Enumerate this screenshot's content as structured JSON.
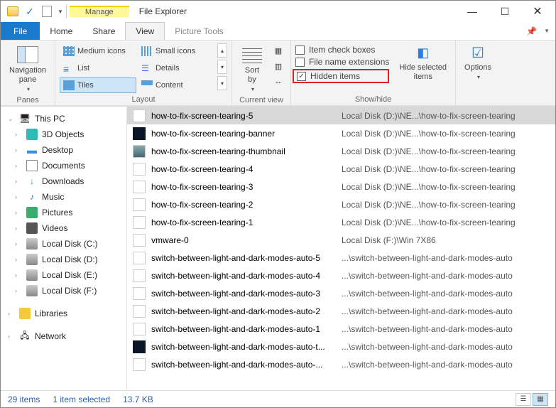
{
  "title": "File Explorer",
  "contextual_tab": "Manage",
  "menu": {
    "file": "File",
    "home": "Home",
    "share": "Share",
    "view": "View",
    "picture_tools": "Picture Tools"
  },
  "ribbon": {
    "panes": {
      "label": "Panes",
      "nav_pane": "Navigation\npane"
    },
    "layout": {
      "label": "Layout",
      "medium": "Medium icons",
      "small": "Small icons",
      "list": "List",
      "details": "Details",
      "tiles": "Tiles",
      "content": "Content"
    },
    "current_view": {
      "label": "Current view",
      "sort": "Sort\nby"
    },
    "showhide": {
      "label": "Show/hide",
      "item_check": "Item check boxes",
      "file_ext": "File name extensions",
      "hidden": "Hidden items",
      "hide_selected": "Hide selected\nitems"
    },
    "options": "Options"
  },
  "tree": {
    "this_pc": "This PC",
    "objects3d": "3D Objects",
    "desktop": "Desktop",
    "documents": "Documents",
    "downloads": "Downloads",
    "music": "Music",
    "pictures": "Pictures",
    "videos": "Videos",
    "disk_c": "Local Disk (C:)",
    "disk_d": "Local Disk (D:)",
    "disk_e": "Local Disk (E:)",
    "disk_f": "Local Disk (F:)",
    "libraries": "Libraries",
    "network": "Network"
  },
  "files": [
    {
      "name": "how-to-fix-screen-tearing-5",
      "path": "Local Disk (D:)\\NE...\\how-to-fix-screen-tearing",
      "thumb": "",
      "selected": true
    },
    {
      "name": "how-to-fix-screen-tearing-banner",
      "path": "Local Disk (D:)\\NE...\\how-to-fix-screen-tearing",
      "thumb": "dark"
    },
    {
      "name": "how-to-fix-screen-tearing-thumbnail",
      "path": "Local Disk (D:)\\NE...\\how-to-fix-screen-tearing",
      "thumb": "photo"
    },
    {
      "name": "how-to-fix-screen-tearing-4",
      "path": "Local Disk (D:)\\NE...\\how-to-fix-screen-tearing",
      "thumb": ""
    },
    {
      "name": "how-to-fix-screen-tearing-3",
      "path": "Local Disk (D:)\\NE...\\how-to-fix-screen-tearing",
      "thumb": ""
    },
    {
      "name": "how-to-fix-screen-tearing-2",
      "path": "Local Disk (D:)\\NE...\\how-to-fix-screen-tearing",
      "thumb": ""
    },
    {
      "name": "how-to-fix-screen-tearing-1",
      "path": "Local Disk (D:)\\NE...\\how-to-fix-screen-tearing",
      "thumb": ""
    },
    {
      "name": "vmware-0",
      "path": "Local Disk (F:)\\Win 7X86",
      "thumb": ""
    },
    {
      "name": "switch-between-light-and-dark-modes-auto-5",
      "path": "...\\switch-between-light-and-dark-modes-auto",
      "thumb": ""
    },
    {
      "name": "switch-between-light-and-dark-modes-auto-4",
      "path": "...\\switch-between-light-and-dark-modes-auto",
      "thumb": ""
    },
    {
      "name": "switch-between-light-and-dark-modes-auto-3",
      "path": "...\\switch-between-light-and-dark-modes-auto",
      "thumb": ""
    },
    {
      "name": "switch-between-light-and-dark-modes-auto-2",
      "path": "...\\switch-between-light-and-dark-modes-auto",
      "thumb": ""
    },
    {
      "name": "switch-between-light-and-dark-modes-auto-1",
      "path": "...\\switch-between-light-and-dark-modes-auto",
      "thumb": ""
    },
    {
      "name": "switch-between-light-and-dark-modes-auto-t...",
      "path": "...\\switch-between-light-and-dark-modes-auto",
      "thumb": "dark"
    },
    {
      "name": "switch-between-light-and-dark-modes-auto-...",
      "path": "...\\switch-between-light-and-dark-modes-auto",
      "thumb": ""
    }
  ],
  "status": {
    "count": "29 items",
    "selected": "1 item selected",
    "size": "13.7 KB"
  }
}
